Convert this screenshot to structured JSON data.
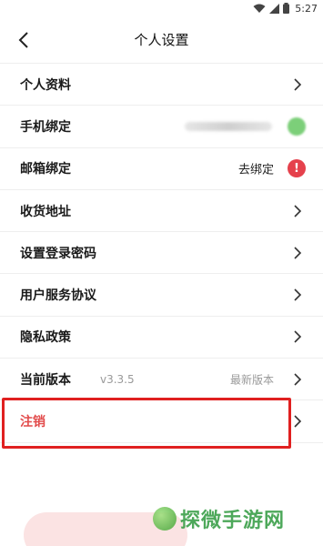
{
  "status_bar": {
    "time": "5:27"
  },
  "header": {
    "title": "个人设置"
  },
  "rows": {
    "profile": {
      "label": "个人资料"
    },
    "phone": {
      "label": "手机绑定"
    },
    "email": {
      "label": "邮箱绑定",
      "status": "去绑定"
    },
    "address": {
      "label": "收货地址"
    },
    "password": {
      "label": "设置登录密码"
    },
    "agreement": {
      "label": "用户服务协议"
    },
    "privacy": {
      "label": "隐私政策"
    },
    "version": {
      "label": "当前版本",
      "value": "v3.3.5",
      "status": "最新版本"
    },
    "cancel": {
      "label": "注销"
    }
  },
  "watermark": {
    "text": "探微手游网"
  },
  "colors": {
    "accent_red": "#e24b4b",
    "alert_red": "#e5414c",
    "green": "#7ccf79"
  }
}
